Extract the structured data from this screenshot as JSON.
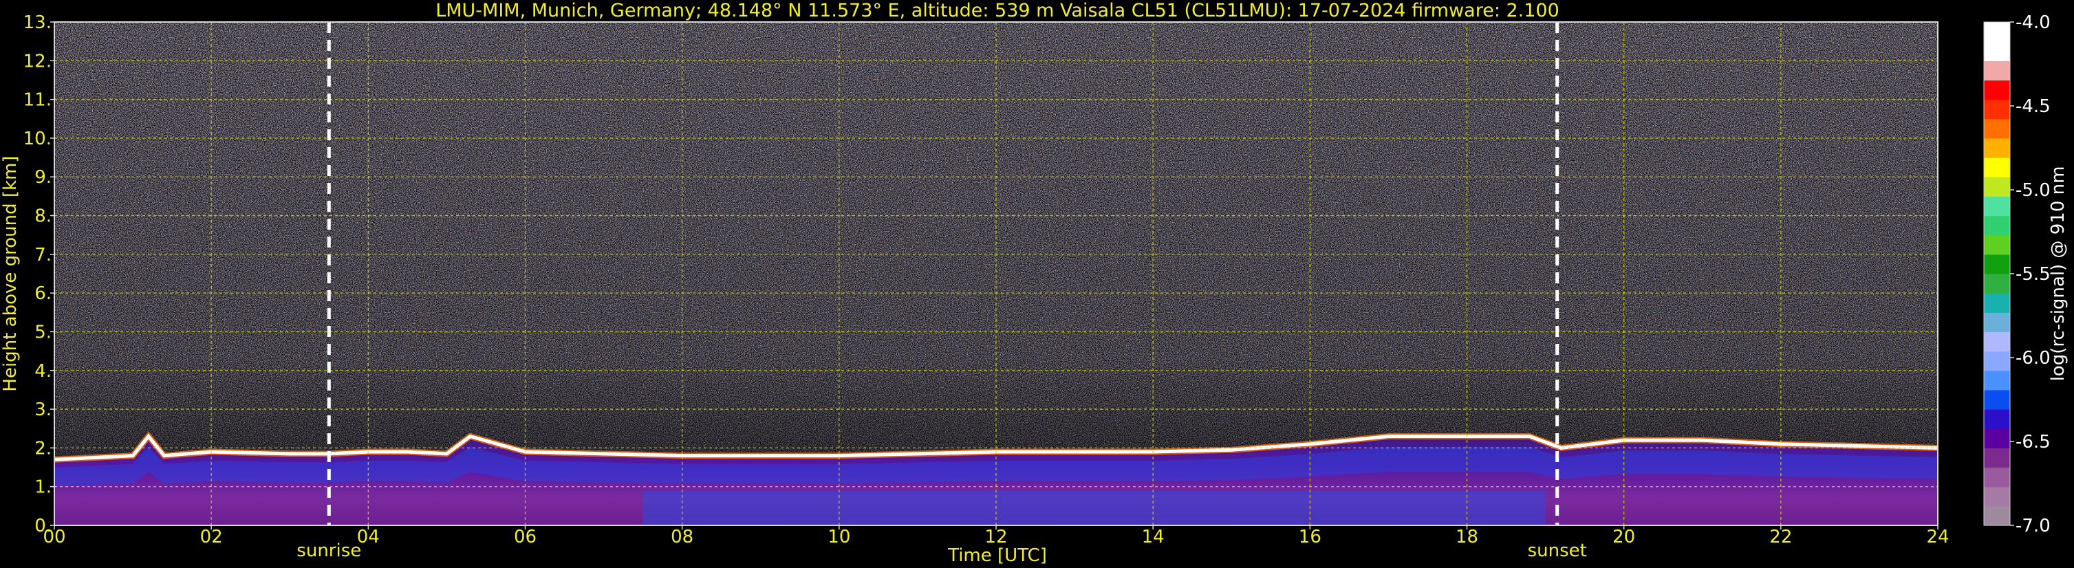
{
  "chart_data": {
    "type": "heatmap",
    "title": "LMU-MIM, Munich, Germany; 48.148° N 11.573° E, altitude: 539 m    Vaisala CL51 (CL51LMU): 17-07-2024    firmware: 2.100",
    "xlabel": "Time [UTC]",
    "ylabel": "Height above ground [km]",
    "xlim": [
      0,
      24
    ],
    "ylim": [
      0,
      13
    ],
    "x_ticks": [
      "00",
      "02",
      "04",
      "06",
      "08",
      "10",
      "12",
      "14",
      "16",
      "18",
      "20",
      "22",
      "24"
    ],
    "y_ticks": [
      "0.",
      "1.",
      "2.",
      "3.",
      "4.",
      "5.",
      "6.",
      "7.",
      "8.",
      "9.",
      "10.",
      "11.",
      "12.",
      "13."
    ],
    "grid": true,
    "annotations": [
      {
        "label": "sunrise",
        "x": 3.5
      },
      {
        "label": "sunset",
        "x": 19.15
      }
    ],
    "colorbar": {
      "label": "log(rc-signal) @ 910 nm",
      "range": [
        -7.0,
        -4.0
      ],
      "ticks": [
        "-4.0",
        "-4.5",
        "-5.0",
        "-5.5",
        "-6.0",
        "-6.5",
        "-7.0"
      ],
      "tick_values": [
        -4.0,
        -4.5,
        -5.0,
        -5.5,
        -6.0,
        -6.5,
        -7.0
      ],
      "colors": [
        "#9e8a9e",
        "#a57aa5",
        "#9a5a9e",
        "#7c2a8e",
        "#5a00a0",
        "#2a10c8",
        "#0a4ef0",
        "#4a90ff",
        "#8aa8ff",
        "#b0b8ff",
        "#6ab0d8",
        "#1ab0b0",
        "#30b040",
        "#10a010",
        "#60d020",
        "#30d070",
        "#50e0a0",
        "#c0e820",
        "#ffff00",
        "#ffb000",
        "#ff7000",
        "#ff3000",
        "#ff0000",
        "#f0a8a8",
        "#ffffff",
        "#ffffff"
      ]
    },
    "boundary_layer_top": {
      "x": [
        0,
        0.5,
        1.0,
        1.2,
        1.4,
        2.0,
        3.0,
        3.5,
        4.0,
        4.5,
        5.0,
        5.3,
        6.0,
        7.0,
        8.0,
        9.0,
        10.0,
        11.0,
        12.0,
        13.0,
        14.0,
        15.0,
        16.0,
        17.0,
        18.0,
        18.8,
        19.2,
        20.0,
        21.0,
        22.0,
        24.0
      ],
      "y": [
        1.7,
        1.75,
        1.8,
        2.3,
        1.8,
        1.9,
        1.85,
        1.85,
        1.9,
        1.9,
        1.85,
        2.3,
        1.9,
        1.85,
        1.8,
        1.8,
        1.8,
        1.85,
        1.9,
        1.9,
        1.9,
        1.95,
        2.1,
        2.3,
        2.3,
        2.3,
        2.0,
        2.2,
        2.2,
        2.1,
        2.0
      ]
    }
  }
}
